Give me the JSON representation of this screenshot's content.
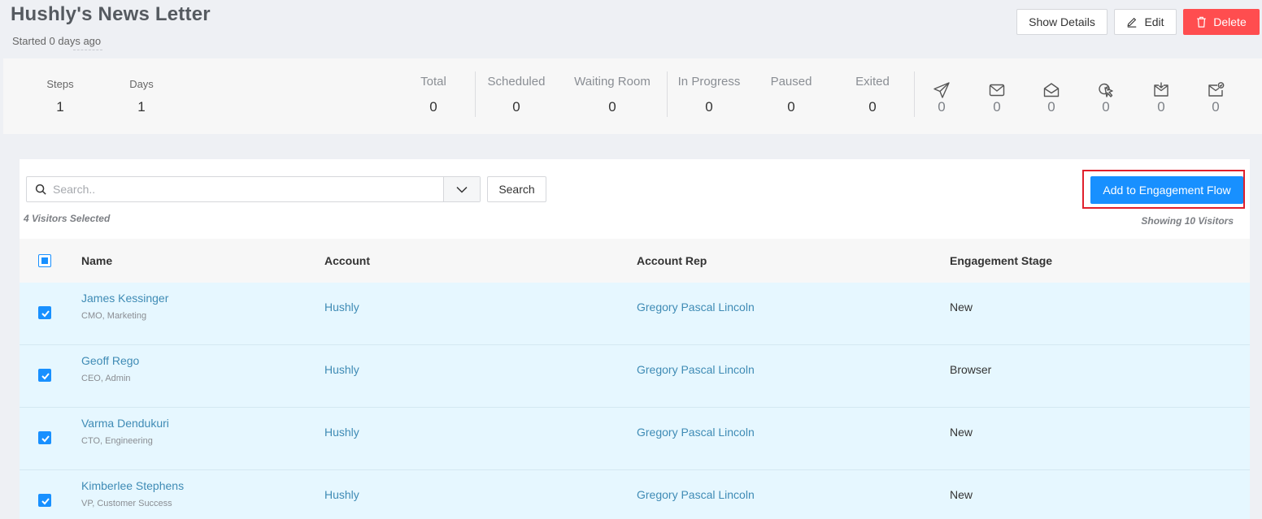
{
  "header": {
    "title": "Hushly's News Letter",
    "subtitle": "Started 0 days ago",
    "show_details_label": "Show Details",
    "edit_label": "Edit",
    "delete_label": "Delete"
  },
  "stats": {
    "steps": {
      "label": "Steps",
      "value": "1"
    },
    "days": {
      "label": "Days",
      "value": "1"
    },
    "total": {
      "label": "Total",
      "value": "0"
    },
    "scheduled": {
      "label": "Scheduled",
      "value": "0"
    },
    "waiting_room": {
      "label": "Waiting Room",
      "value": "0"
    },
    "in_progress": {
      "label": "In Progress",
      "value": "0"
    },
    "paused": {
      "label": "Paused",
      "value": "0"
    },
    "exited": {
      "label": "Exited",
      "value": "0"
    },
    "email_metrics": [
      {
        "icon": "send-icon",
        "value": "0"
      },
      {
        "icon": "mail-icon",
        "value": "0"
      },
      {
        "icon": "mail-open-icon",
        "value": "0"
      },
      {
        "icon": "click-icon",
        "value": "0"
      },
      {
        "icon": "mail-download-icon",
        "value": "0"
      },
      {
        "icon": "mail-check-icon",
        "value": "0"
      }
    ]
  },
  "toolbar": {
    "search_placeholder": "Search..",
    "search_button_label": "Search",
    "selected_text": "4 Visitors Selected",
    "add_button_label": "Add to Engagement Flow",
    "showing_text": "Showing 10 Visitors"
  },
  "table": {
    "columns": [
      "Name",
      "Account",
      "Account Rep",
      "Engagement Stage"
    ],
    "rows": [
      {
        "name": "James Kessinger",
        "title": "CMO, Marketing",
        "account": "Hushly",
        "rep": "Gregory Pascal Lincoln",
        "stage": "New"
      },
      {
        "name": "Geoff Rego",
        "title": "CEO, Admin",
        "account": "Hushly",
        "rep": "Gregory Pascal Lincoln",
        "stage": "Browser"
      },
      {
        "name": "Varma Dendukuri",
        "title": "CTO, Engineering",
        "account": "Hushly",
        "rep": "Gregory Pascal Lincoln",
        "stage": "New"
      },
      {
        "name": "Kimberlee Stephens",
        "title": "VP, Customer Success",
        "account": "Hushly",
        "rep": "Gregory Pascal Lincoln",
        "stage": "New"
      }
    ]
  },
  "colors": {
    "primary": "#1890ff",
    "danger": "#ff4d4f",
    "link": "#3f8bb5",
    "row_selected": "#e6f7ff",
    "highlight": "#e0202c"
  }
}
